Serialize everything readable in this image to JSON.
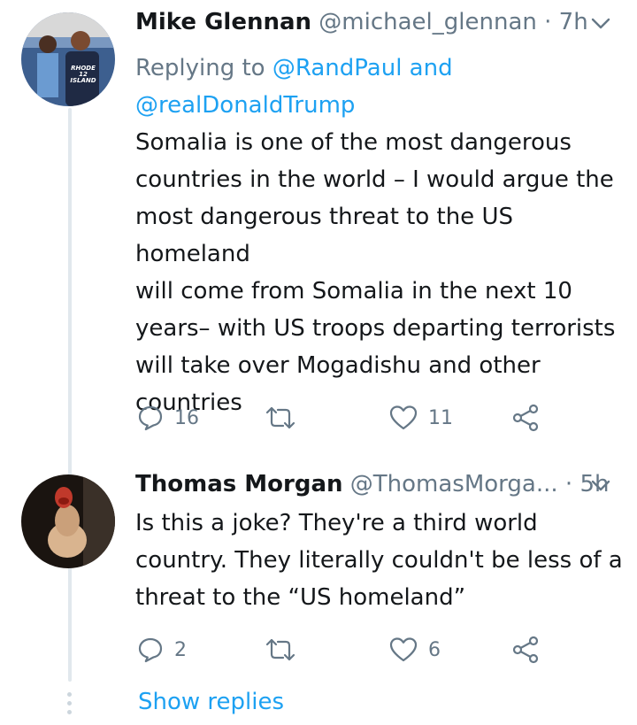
{
  "tweets": [
    {
      "name": "Mike Glennan",
      "handle": "@michael_glennan",
      "dot": "·",
      "time": "7h",
      "replying_prefix": "Replying to ",
      "replying_mention_1": "@RandPaul",
      "replying_and": " and",
      "replying_mention_2": "@realDonaldTrump",
      "text_lines": [
        "Somalia is one of the most dangerous",
        "countries in the world – I would argue the",
        "most dangerous threat to the US homeland",
        "will come from Somalia in the next 10",
        "years– with US troops departing terrorists",
        "will take over Mogadishu and other",
        "countries"
      ],
      "reply_count": "16",
      "retweet_count": "",
      "like_count": "11",
      "avatar_shirt_text_1": "RHODE",
      "avatar_shirt_text_2": "12",
      "avatar_shirt_text_3": "ISLAND"
    },
    {
      "name": "Thomas Morgan",
      "handle": "@ThomasMorga...",
      "dot": "·",
      "time": "5h",
      "text_lines": [
        "Is this a joke? They're a third world",
        "country. They literally couldn't be less of a",
        "threat to the “US homeland”"
      ],
      "reply_count": "2",
      "retweet_count": "",
      "like_count": "6"
    }
  ],
  "show_replies": "Show replies",
  "colors": {
    "accent": "#1da1f2",
    "secondary_text": "#657786",
    "icon": "#657786",
    "thread_line": "#e1e8ed"
  },
  "icons": [
    "reply-icon",
    "retweet-icon",
    "like-icon",
    "share-icon",
    "chevron-down-icon"
  ]
}
